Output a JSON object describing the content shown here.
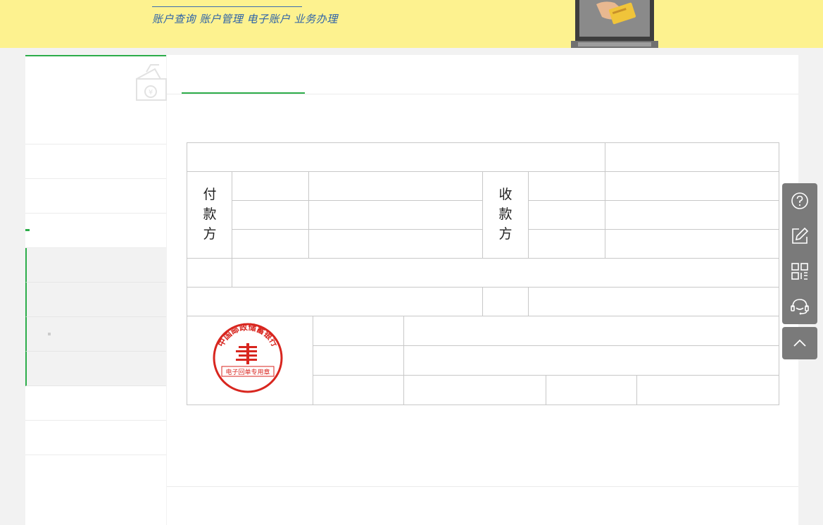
{
  "banner": {
    "slogan": "账户查询 账户管理 电子账户 业务办理"
  },
  "sidebar": {
    "items": [
      {
        "label": ""
      },
      {
        "label": ""
      },
      {
        "label": ""
      },
      {
        "label": ""
      }
    ],
    "sub_items": [
      {
        "label": ""
      },
      {
        "label": ""
      },
      {
        "label": ""
      },
      {
        "label": ""
      }
    ],
    "bottom_items": [
      {
        "label": ""
      },
      {
        "label": ""
      }
    ]
  },
  "main": {
    "tab_label": ""
  },
  "receipt": {
    "payer_label": [
      "付",
      "款",
      "方"
    ],
    "payee_label": [
      "收",
      "款",
      "方"
    ],
    "seal_name": "中国邮政储蓄银行",
    "seal_caption": "电子回单专用章"
  },
  "float_bar": {
    "icons": [
      "help-icon",
      "edit-icon",
      "qrcode-icon",
      "customer-service-icon",
      "back-to-top-icon"
    ]
  },
  "colors": {
    "accent": "#2cad4a",
    "banner_bg": "#fdf28f",
    "seal_red": "#d8261f",
    "float_bg": "#7a7a7a"
  }
}
